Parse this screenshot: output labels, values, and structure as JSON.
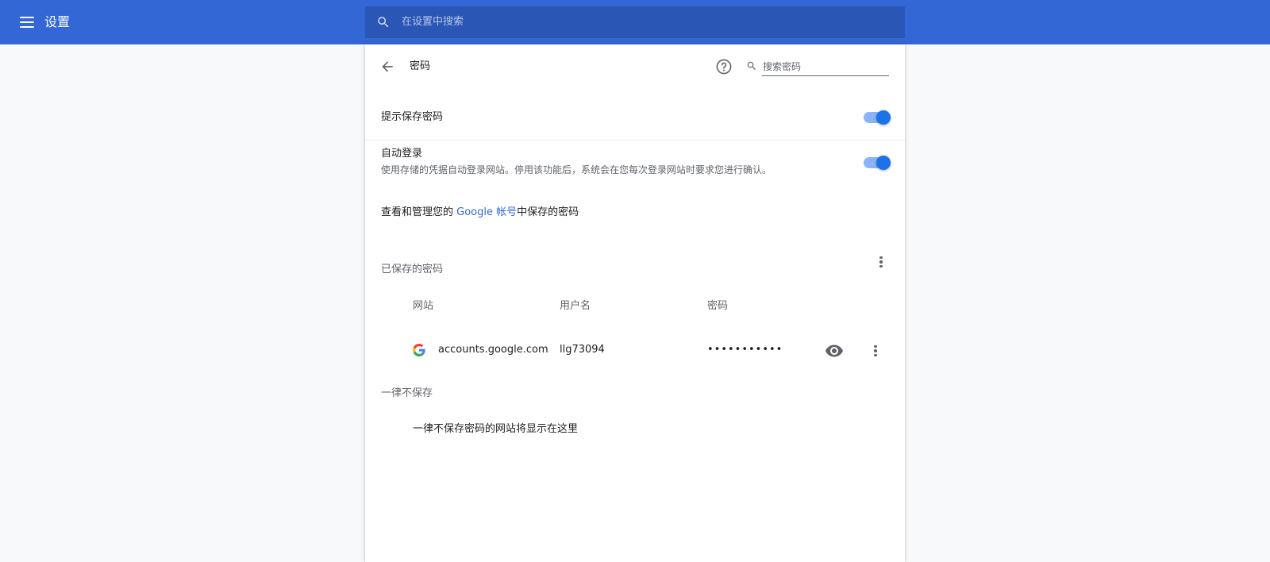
{
  "app": {
    "title": "设置"
  },
  "search": {
    "placeholder": "在设置中搜索"
  },
  "subpage": {
    "title": "密码",
    "search_placeholder": "搜索密码"
  },
  "settings": {
    "offer_to_save": {
      "label": "提示保存密码",
      "enabled": true
    },
    "auto_signin": {
      "label": "自动登录",
      "description": "使用存储的凭据自动登录网站。停用该功能后，系统会在您每次登录网站时要求您进行确认。",
      "enabled": true
    }
  },
  "google_account": {
    "prefix": "查看和管理您的 ",
    "link": "Google 帐号",
    "suffix": "中保存的密码"
  },
  "saved": {
    "title": "已保存的密码",
    "columns": {
      "site": "网站",
      "username": "用户名",
      "password": "密码"
    },
    "rows": [
      {
        "site": "accounts.google.com",
        "username": "llg73094",
        "password": "•••••••••••"
      }
    ]
  },
  "never_saved": {
    "title": "一律不保存",
    "empty": "一律不保存密码的网站将显示在这里"
  },
  "colors": {
    "toolbar": "#3367d6",
    "search": "#2a56b6",
    "accent": "#1a73e8",
    "link": "#3367d6"
  }
}
